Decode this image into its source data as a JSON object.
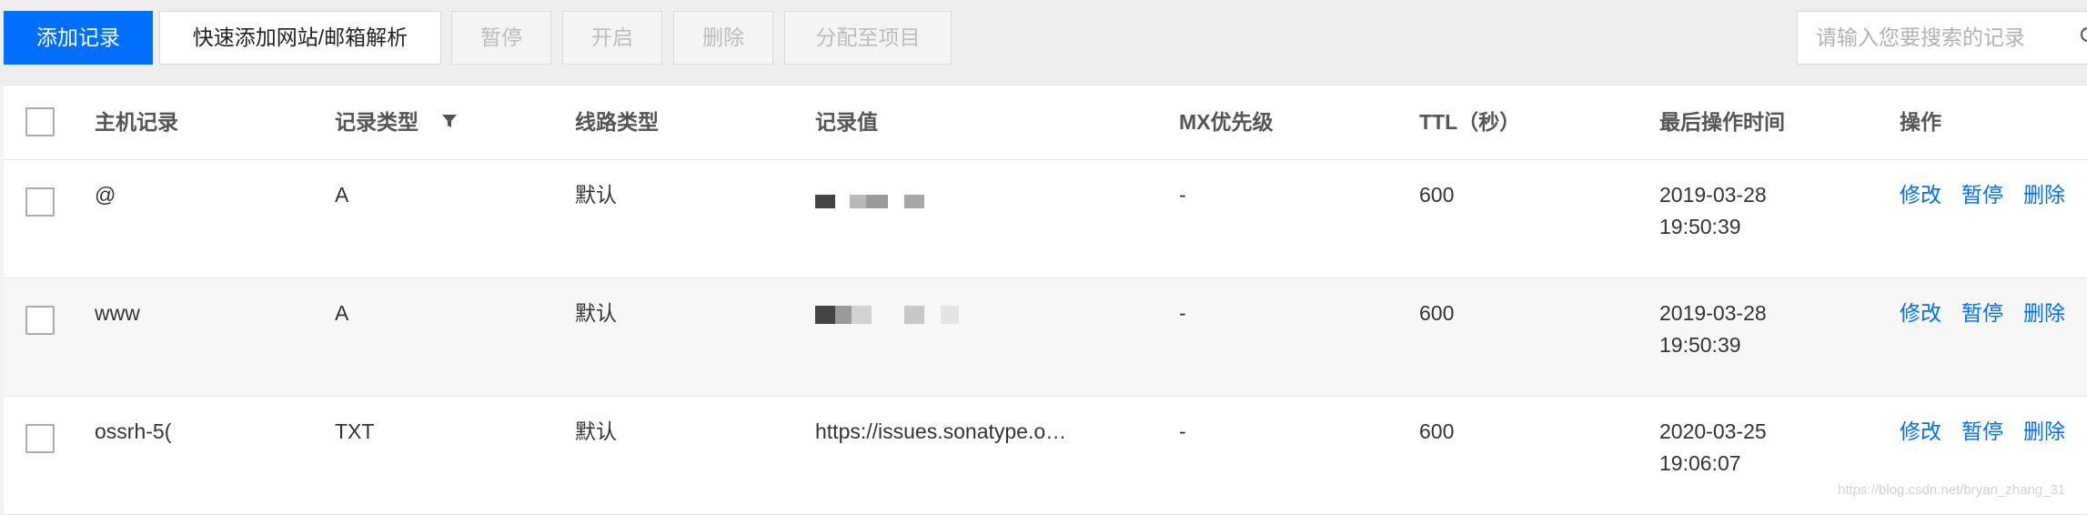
{
  "toolbar": {
    "add_record": "添加记录",
    "quick_add": "快速添加网站/邮箱解析",
    "pause": "暂停",
    "enable": "开启",
    "delete": "删除",
    "assign_project": "分配至项目",
    "search_placeholder": "请输入您要搜索的记录"
  },
  "columns": {
    "host": "主机记录",
    "type": "记录类型",
    "line": "线路类型",
    "value": "记录值",
    "mx": "MX优先级",
    "ttl": "TTL（秒）",
    "last_op": "最后操作时间",
    "actions": "操作"
  },
  "rows": [
    {
      "host": "@",
      "type": "A",
      "line": "默认",
      "value": "",
      "mx": "-",
      "ttl": "600",
      "date": "2019-03-28",
      "time": "19:50:39",
      "edit": "修改",
      "pause": "暂停",
      "delete": "删除"
    },
    {
      "host": "www",
      "type": "A",
      "line": "默认",
      "value": "",
      "mx": "-",
      "ttl": "600",
      "date": "2019-03-28",
      "time": "19:50:39",
      "edit": "修改",
      "pause": "暂停",
      "delete": "删除"
    },
    {
      "host": "ossrh-5(",
      "type": "TXT",
      "line": "默认",
      "value": "https://issues.sonatype.o…",
      "mx": "-",
      "ttl": "600",
      "date": "2020-03-25",
      "time": "19:06:07",
      "edit": "修改",
      "pause": "暂停",
      "delete": "删除"
    }
  ],
  "watermark": "https://blog.csdn.net/bryan_zhang_31",
  "colors": {
    "primary": "#006eff",
    "link": "#006eff",
    "disabled_text": "#bdbdbd",
    "toolbar_bg": "#eeeeee",
    "alt_row_bg": "#f7f7f7"
  },
  "icons": {
    "filter": "filter-icon",
    "search": "search-icon"
  }
}
